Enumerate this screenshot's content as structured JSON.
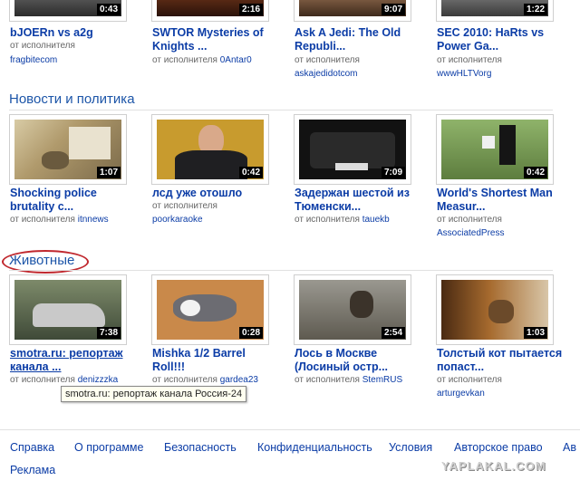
{
  "rows": [
    {
      "section": "",
      "videos": [
        {
          "title": "bJOERn vs a2g",
          "meta_prefix": "от исполнителя",
          "author": "fragbitecom",
          "duration": "0:43"
        },
        {
          "title": "SWTOR Mysteries of Knights ...",
          "meta_prefix": "от исполнителя",
          "author": "0Antar0",
          "duration": "2:16"
        },
        {
          "title": "Ask A Jedi: The Old Republi...",
          "meta_prefix": "от исполнителя",
          "author": "askajedidotcom",
          "duration": "9:07"
        },
        {
          "title": "SEC 2010: HaRts vs Power Ga...",
          "meta_prefix": "от исполнителя",
          "author": "wwwHLTVorg",
          "duration": "1:22"
        }
      ]
    },
    {
      "section": "Новости и политика",
      "videos": [
        {
          "title": "Shocking police brutality c...",
          "meta_prefix": "от исполнителя",
          "author": "itnnews",
          "duration": "1:07"
        },
        {
          "title": "лсд уже отошло",
          "meta_prefix": "от исполнителя",
          "author": "poorkaraoke",
          "duration": "0:42"
        },
        {
          "title": "Задержан шестой из Тюменски...",
          "meta_prefix": "от исполнителя",
          "author": "tauekb",
          "duration": "7:09"
        },
        {
          "title": "World's Shortest Man Measur...",
          "meta_prefix": "от исполнителя",
          "author": "AssociatedPress",
          "duration": "0:42"
        }
      ]
    },
    {
      "section": "Животные",
      "videos": [
        {
          "title": "smotra.ru: репортаж канала ...",
          "meta_prefix": "от исполнителя",
          "author": "denizzzka",
          "duration": "7:38"
        },
        {
          "title": "Mishka 1/2 Barrel Roll!!!",
          "meta_prefix": "от исполнителя",
          "author": "gardea23",
          "duration": "0:28"
        },
        {
          "title": "Лось в Москве (Лосиный остр...",
          "meta_prefix": "от исполнителя",
          "author": "StemRUS",
          "duration": "2:54"
        },
        {
          "title": "Толстый кот пытается попаст...",
          "meta_prefix": "от исполнителя",
          "author": "arturgevkan",
          "duration": "1:03"
        }
      ]
    }
  ],
  "tooltip": "smotra.ru: репортаж канала Россия-24",
  "footer": {
    "links": [
      "Справка",
      "О программе",
      "Безопасность",
      "Конфиденциальность",
      "Условия",
      "Авторское право",
      "Ав",
      "Реклама"
    ]
  },
  "watermark": "YAPLAKAL.COM",
  "colors": {
    "link": "#0b3ca6",
    "section": "#1c55a8",
    "circle": "#c0282e"
  }
}
